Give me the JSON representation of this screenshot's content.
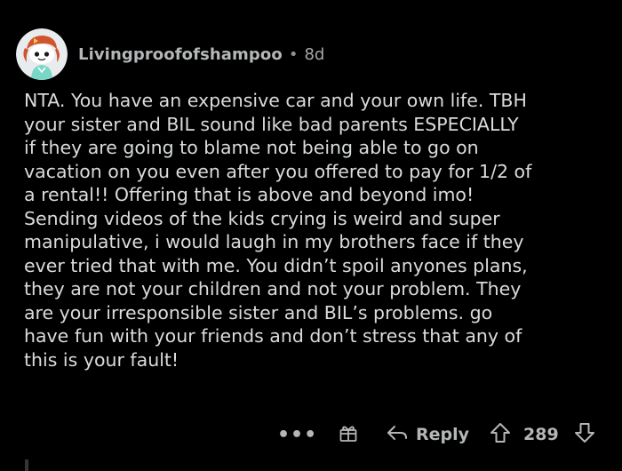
{
  "comment": {
    "username": "Livingproofofshampoo",
    "separator": "•",
    "age": "8d",
    "body_lines": [
      "NTA. You have an expensive car and your own life. TBH",
      "your sister and BIL sound like bad parents ESPECIALLY",
      "if they are going to blame not being able to go on",
      "vacation on you even after you offered to pay for 1/2 of",
      "a rental!! Offering that is above and beyond imo!",
      "Sending videos of the kids crying is weird and super",
      "manipulative, i would laugh in my brothers face if they",
      "ever tried that with me. You didn’t spoil anyones plans,",
      "they are not your children and not your problem. They",
      "are your irresponsible sister and BIL’s problems. go",
      "have fun with your friends and don’t stress that any of",
      "this is your fault!"
    ]
  },
  "actions": {
    "more": "•••",
    "reply_label": "Reply",
    "score": "289"
  },
  "icons": {
    "avatar": "snoo-avatar-icon",
    "more": "more-options-icon",
    "award": "gift-award-icon",
    "reply": "reply-arrow-icon",
    "upvote": "upvote-arrow-icon",
    "downvote": "downvote-arrow-icon"
  },
  "colors": {
    "background": "#000000",
    "text": "#d9dbdd",
    "muted": "#b4b6b8"
  }
}
